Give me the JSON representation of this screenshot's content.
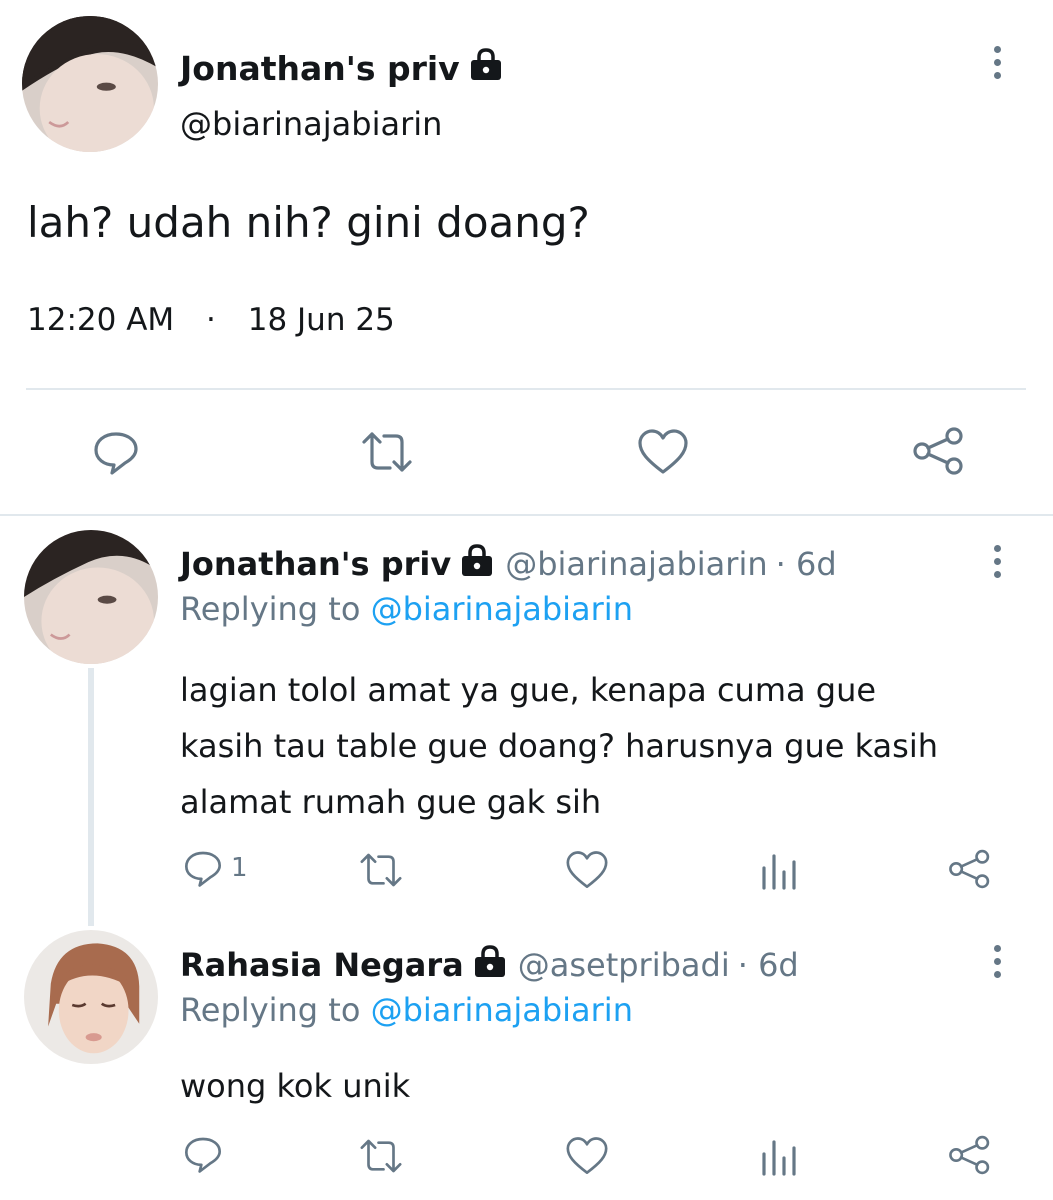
{
  "main_tweet": {
    "display_name": "Jonathan's priv",
    "handle": "@biarinajabiarin",
    "text": "lah? udah nih? gini doang?",
    "time": "12:20 AM",
    "separator": "·",
    "date": "18 Jun 25",
    "actions": [
      "reply-icon",
      "retweet-icon",
      "like-icon",
      "share-icon"
    ]
  },
  "replies": [
    {
      "display_name": "Jonathan's priv",
      "handle": "@biarinajabiarin",
      "age": "· 6d",
      "replying_prefix": "Replying to",
      "replying_to": "@biarinajabiarin",
      "text_lines": [
        "lagian tolol amat ya gue, kenapa cuma gue",
        "kasih tau table gue doang? harusnya gue kasih",
        "alamat rumah gue gak sih"
      ],
      "reply_count": "1"
    },
    {
      "display_name": "Rahasia Negara",
      "handle": "@asetpribadi",
      "age": "· 6d",
      "replying_prefix": "Replying to",
      "replying_to": "@biarinajabiarin",
      "text_lines": [
        "wong kok unik"
      ],
      "reply_count": ""
    }
  ],
  "colors": {
    "text": "#14171a",
    "muted": "#657786",
    "link": "#1da1f2",
    "divider": "#e1e8ed"
  }
}
